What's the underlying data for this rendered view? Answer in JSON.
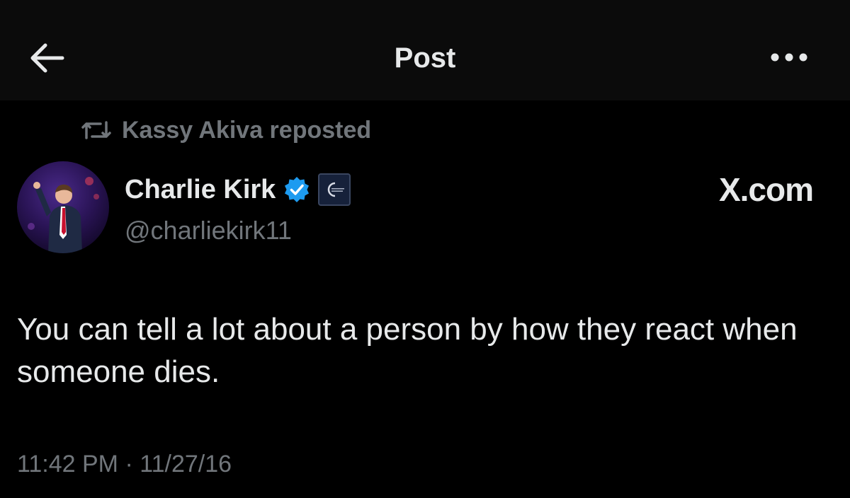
{
  "header": {
    "title": "Post",
    "back_icon": "arrow-left-icon",
    "more_icon": "more-horizontal-icon"
  },
  "repost": {
    "icon": "repost-icon",
    "text": "Kassy Akiva reposted"
  },
  "author": {
    "name": "Charlie Kirk",
    "handle": "@charliekirk11",
    "verified_icon": "verified-badge-icon",
    "affiliate_icon": "organization-affiliate-badge-icon"
  },
  "source_label": "X.com",
  "post": {
    "text": "You can tell a lot about a person by how they react when someone dies.",
    "timestamp": "11:42 PM · 11/27/16"
  },
  "colors": {
    "background": "#000000",
    "header_background": "#0b0b0b",
    "primary_text": "#e7e9ea",
    "secondary_text": "#71767b",
    "verified_blue": "#1d9bf0"
  }
}
